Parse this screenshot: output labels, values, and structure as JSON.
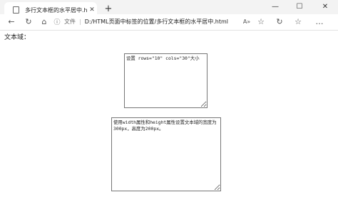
{
  "tab": {
    "title": "多行文本框的水平居中.html",
    "close": "✕"
  },
  "window": {
    "new_tab": "+",
    "minimize": "—",
    "maximize": "☐",
    "close": "✕"
  },
  "toolbar": {
    "back": "←",
    "refresh": "↻",
    "home": "⌂",
    "info_icon": "ⓘ",
    "file_label": "文件",
    "sep": "|",
    "url": "D:/HTML页面中标签的位置/多行文本框的水平居中.html",
    "read_aloud": "A»",
    "favorite": "☆",
    "refresh_page": "↻",
    "collections": "☆",
    "more": "…"
  },
  "page": {
    "label": "文本域：",
    "textarea1": "设置 rows=\"10\" cols=\"30\"大小",
    "textarea2": "使用width属性和height属性设置文本域的宽度为300px，高度为200px。"
  }
}
